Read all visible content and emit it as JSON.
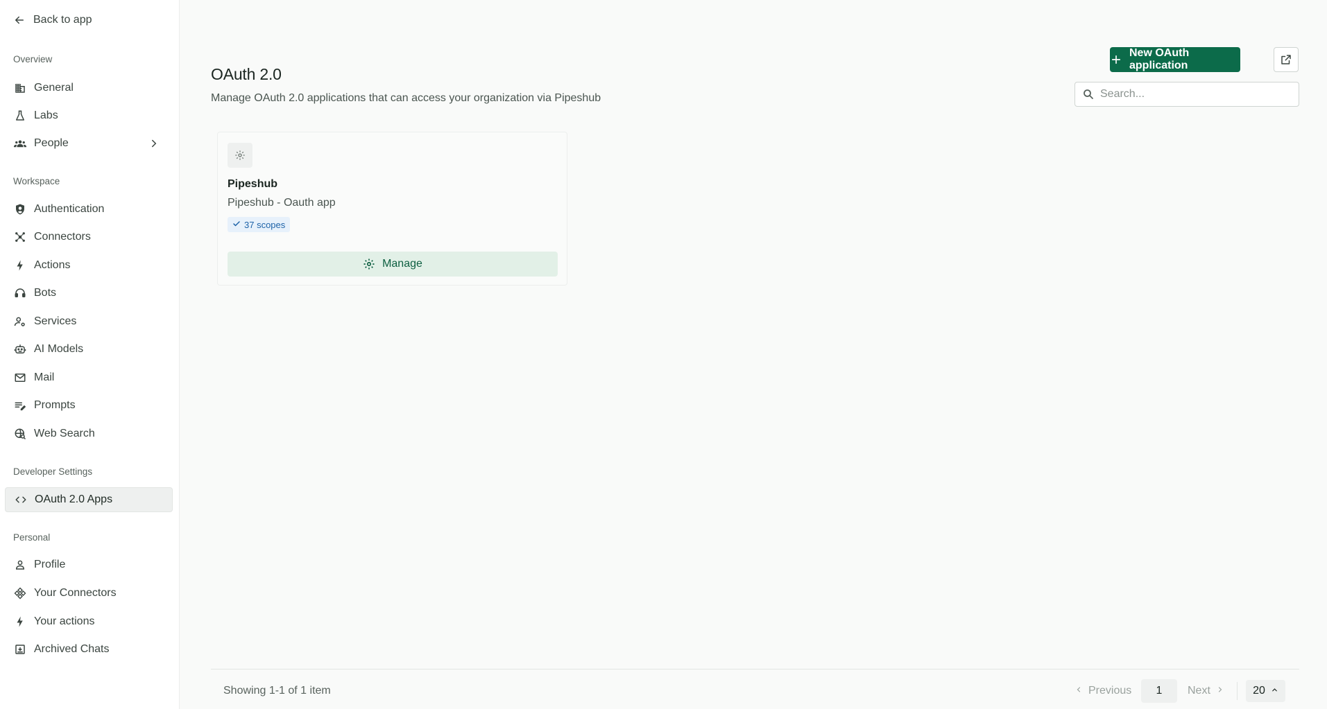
{
  "sidebar": {
    "back_label": "Back to app",
    "sections": {
      "overview": "Overview",
      "workspace": "Workspace",
      "developer": "Developer Settings",
      "personal": "Personal"
    },
    "items": {
      "general": "General",
      "labs": "Labs",
      "people": "People",
      "authentication": "Authentication",
      "connectors": "Connectors",
      "actions": "Actions",
      "bots": "Bots",
      "services": "Services",
      "ai_models": "AI Models",
      "mail": "Mail",
      "prompts": "Prompts",
      "web_search": "Web Search",
      "oauth_apps": "OAuth 2.0 Apps",
      "profile": "Profile",
      "your_connectors": "Your Connectors",
      "your_actions": "Your actions",
      "archived_chats": "Archived Chats"
    },
    "active_item": "OAuth 2.0 Apps"
  },
  "header": {
    "title": "OAuth 2.0",
    "subtitle": "Manage OAuth 2.0 applications that can access your organization via Pipeshub",
    "new_button_label": "New OAuth application",
    "search_placeholder": "Search..."
  },
  "apps": [
    {
      "name": "Pipeshub",
      "description": "Pipeshub - Oauth app",
      "scopes_label": "37 scopes",
      "manage_label": "Manage"
    }
  ],
  "pagination": {
    "summary": "Showing 1-1 of 1 item",
    "previous_label": "Previous",
    "current_page": "1",
    "next_label": "Next",
    "page_size": "20"
  },
  "colors": {
    "primary": "#0c6b4a",
    "manage_bg": "#e2f0e7",
    "scope_badge_bg": "#e7f1fb",
    "scope_badge_text": "#1e63a8"
  }
}
